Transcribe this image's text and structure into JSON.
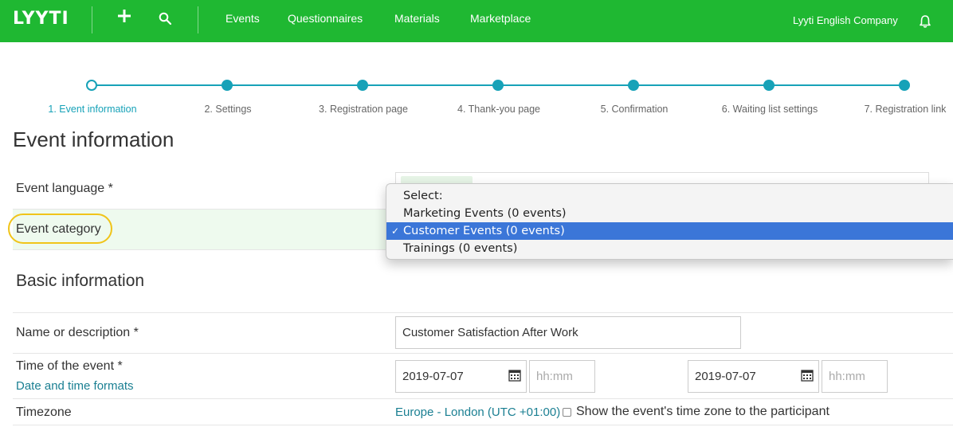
{
  "header": {
    "logo": "LYYTI",
    "nav": [
      "Events",
      "Questionnaires",
      "Materials",
      "Marketplace"
    ],
    "company": "Lyyti English Company"
  },
  "stepper": {
    "current": 0,
    "steps": [
      "1. Event information",
      "2. Settings",
      "3. Registration page",
      "4. Thank-you page",
      "5. Confirmation",
      "6. Waiting list settings",
      "7. Registration link"
    ]
  },
  "form": {
    "title": "Event information",
    "language_label": "Event language *",
    "category_label": "Event category",
    "category_options": [
      "Select:",
      "Marketing Events (0 events)",
      "Customer Events (0 events)",
      "Trainings (0 events)"
    ],
    "category_selected": "Customer Events (0 events)",
    "basic_title": "Basic information",
    "name_label": "Name or description *",
    "name_value": "Customer Satisfaction After Work",
    "time_label": "Time of the event *",
    "formats_link": "Date and time formats",
    "start_date": "2019-07-07",
    "start_time_placeholder": "hh:mm",
    "end_date": "2019-07-07",
    "end_time_placeholder": "hh:mm",
    "timezone_label": "Timezone",
    "timezone_value": "Europe - London (UTC +01:00)",
    "timezone_checkbox_label": "Show the event's time zone to the participant",
    "timezone_checkbox_checked": false
  },
  "colors": {
    "brand_green": "#1fb832",
    "accent_teal": "#17a2b8",
    "highlight_ring": "#f0c419",
    "selection_blue": "#3b76d8"
  },
  "icons": [
    "plus-icon",
    "search-icon",
    "bell-icon",
    "calendar-icon",
    "checkmark-icon"
  ]
}
